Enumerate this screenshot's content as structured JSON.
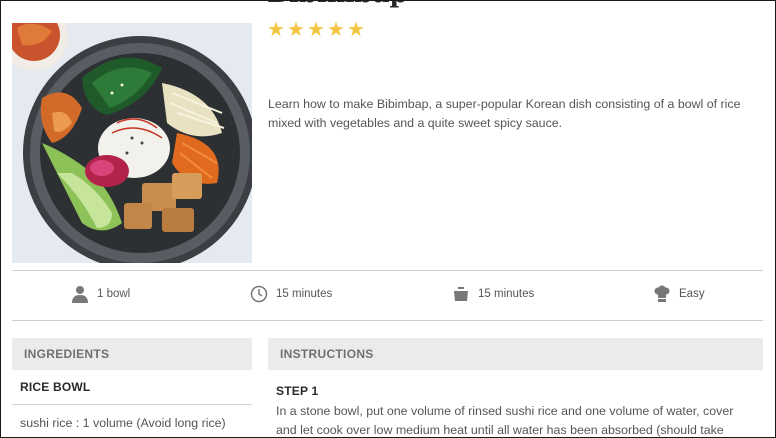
{
  "recipe": {
    "title": "Bibimbap",
    "rating_stars": 5,
    "description": "Learn how to make Bibimbap, a super-popular Korean dish consisting of a bowl of rice mixed with vegetables and a quite sweet spicy sauce."
  },
  "meta": {
    "servings": "1 bowl",
    "prep_time": "15 minutes",
    "cook_time": "15 minutes",
    "difficulty": "Easy"
  },
  "ingredients": {
    "header": "INGREDIENTS",
    "group_title": "RICE BOWL",
    "first_item": "sushi rice : 1 volume (Avoid long rice)"
  },
  "instructions": {
    "header": "INSTRUCTIONS",
    "step_title": "STEP 1",
    "step_text": "In a stone bowl, put one volume of rinsed sushi rice and one volume of water, cover and let cook over low medium heat until all water has been absorbed (should take"
  },
  "colors": {
    "star": "#f4c542",
    "section_bg": "#ebebeb",
    "divider": "#cfcfcf"
  }
}
